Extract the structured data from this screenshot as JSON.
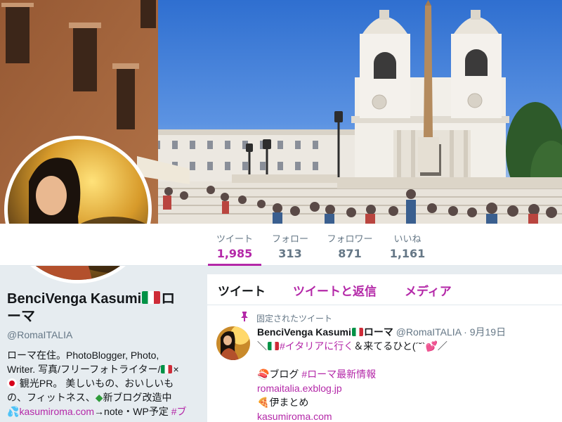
{
  "header": {
    "photo": "Spanish Steps and Trinità dei Monti, Rome"
  },
  "avatar": {
    "alt": "profile photo"
  },
  "stats": [
    {
      "label": "ツイート",
      "value": "1,985",
      "active": true
    },
    {
      "label": "フォロー",
      "value": "313",
      "active": false
    },
    {
      "label": "フォロワー",
      "value": "871",
      "active": false
    },
    {
      "label": "いいね",
      "value": "1,161",
      "active": false
    }
  ],
  "profile": {
    "name_part1": "BenciVenga Kasumi",
    "name_part2": "ロ",
    "name_part3": "ーマ",
    "handle": "@RomaITALIA",
    "bio": {
      "line1": "ローマ在住。PhotoBlogger, Photo,",
      "line2a": "Writer. 写真/フリーフォトライター/",
      "line2b": "×",
      "line3": "観光PR。 美しいもの、おいしいも",
      "line4a": "の、フィットネス、",
      "line4b": "新ブログ改造中",
      "line5_link": "kasumiroma.com",
      "line5_text": "→note・WP予定 ",
      "line5_hashtag": "#ブ"
    }
  },
  "timeline": {
    "tabs": [
      {
        "label": "ツイート"
      },
      {
        "label": "ツイートと返信"
      },
      {
        "label": "メディア"
      }
    ],
    "pinned_label": "固定されたツイート",
    "tweet": {
      "name": "BenciVenga Kasumi",
      "name_suffix": "ローマ",
      "handle": "@RomaITALIA",
      "date": "9月19日",
      "line1a": "＼",
      "line1_hashtag": "#イタリアに行く",
      "line1b": "＆来てるひと(´˘`",
      "line1c": "／",
      "line3_text": "ブログ ",
      "line3_hashtag": "#ローマ最新情報",
      "line4_link": "romaitalia.exblog.jp",
      "line5_text": "伊まとめ",
      "line6_link": "kasumiroma.com"
    }
  },
  "colors": {
    "accent": "#b428a8",
    "muted": "#657786",
    "background": "#e6ecf0"
  }
}
